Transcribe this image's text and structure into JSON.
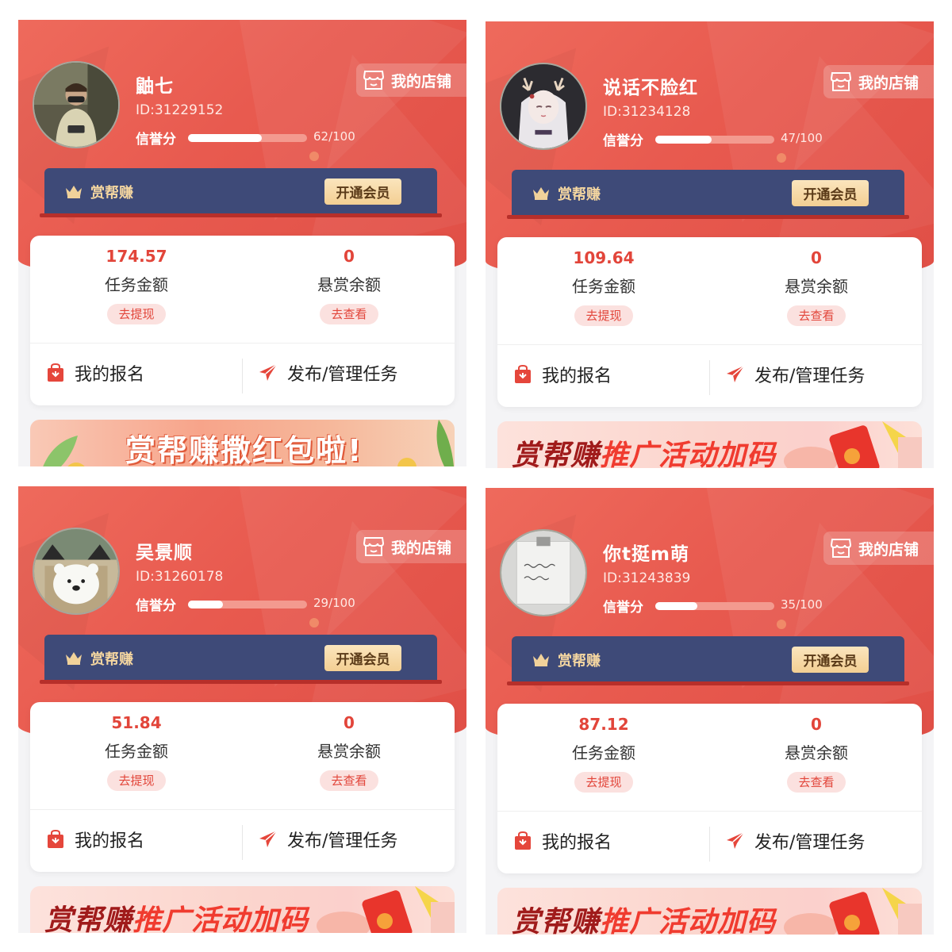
{
  "common": {
    "store_label": "我的店铺",
    "credit_label": "信誉分",
    "vip_title": "赏帮赚",
    "vip_button": "开通会员",
    "task_amount_label": "任务金额",
    "reward_balance_label": "悬赏余额",
    "withdraw_button": "去提现",
    "view_button": "去查看",
    "my_signup_label": "我的报名",
    "publish_label": "发布/管理任务"
  },
  "colors": {
    "header_red": "#e85a4f",
    "vip_navy": "#3e4a78",
    "vip_gold": "#f3cf93",
    "accent_red": "#e2453a"
  },
  "profiles": [
    {
      "name": "鼬七",
      "id_text": "ID:31229152",
      "credit_score": 62,
      "credit_text": "62/100",
      "task_amount": "174.57",
      "reward_balance": "0",
      "promo_style": "a",
      "promo_text": "赏帮赚撒红包啦!",
      "avatar": "person-photo-avatar"
    },
    {
      "name": "说话不脸红",
      "id_text": "ID:31234128",
      "credit_score": 47,
      "credit_text": "47/100",
      "task_amount": "109.64",
      "reward_balance": "0",
      "promo_style": "b",
      "promo_text_a": "赏帮赚",
      "promo_text_b": "推广活动加码",
      "avatar": "anime-deer-girl-avatar"
    },
    {
      "name": "吴景顺",
      "id_text": "ID:31260178",
      "credit_score": 29,
      "credit_text": "29/100",
      "task_amount": "51.84",
      "reward_balance": "0",
      "promo_style": "b",
      "promo_text_a": "赏帮赚",
      "promo_text_b": "推广活动加码",
      "avatar": "polar-bear-avatar"
    },
    {
      "name": "你t挺m萌",
      "id_text": "ID:31243839",
      "credit_score": 35,
      "credit_text": "35/100",
      "task_amount": "87.12",
      "reward_balance": "0",
      "promo_style": "b",
      "promo_text_a": "赏帮赚",
      "promo_text_b": "推广活动加码",
      "avatar": "handwritten-note-avatar"
    }
  ]
}
